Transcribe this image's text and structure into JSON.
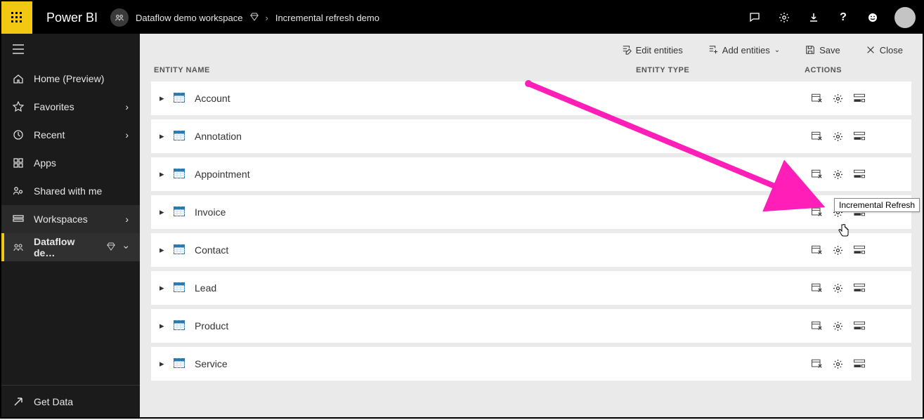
{
  "brand": "Power BI",
  "breadcrumb": {
    "workspace": "Dataflow demo workspace",
    "item": "Incremental refresh demo"
  },
  "nav": {
    "items": [
      {
        "icon": "home",
        "label": "Home (Preview)",
        "chevron": false
      },
      {
        "icon": "star",
        "label": "Favorites",
        "chevron": true
      },
      {
        "icon": "clock",
        "label": "Recent",
        "chevron": true
      },
      {
        "icon": "apps",
        "label": "Apps",
        "chevron": false
      },
      {
        "icon": "shared",
        "label": "Shared with me",
        "chevron": false
      },
      {
        "icon": "ws",
        "label": "Workspaces",
        "chevron": true,
        "active": true
      }
    ],
    "selected_workspace_short": "Dataflow de…",
    "get_data": "Get Data"
  },
  "toolbar": {
    "edit": "Edit entities",
    "add": "Add entities",
    "save": "Save",
    "close": "Close"
  },
  "columns": {
    "name": "Entity Name",
    "type": "Entity Type",
    "actions": "Actions"
  },
  "entities": [
    {
      "name": "Account"
    },
    {
      "name": "Annotation"
    },
    {
      "name": "Appointment"
    },
    {
      "name": "Invoice"
    },
    {
      "name": "Contact"
    },
    {
      "name": "Lead"
    },
    {
      "name": "Product"
    },
    {
      "name": "Service"
    }
  ],
  "tooltip": "Incremental Refresh"
}
